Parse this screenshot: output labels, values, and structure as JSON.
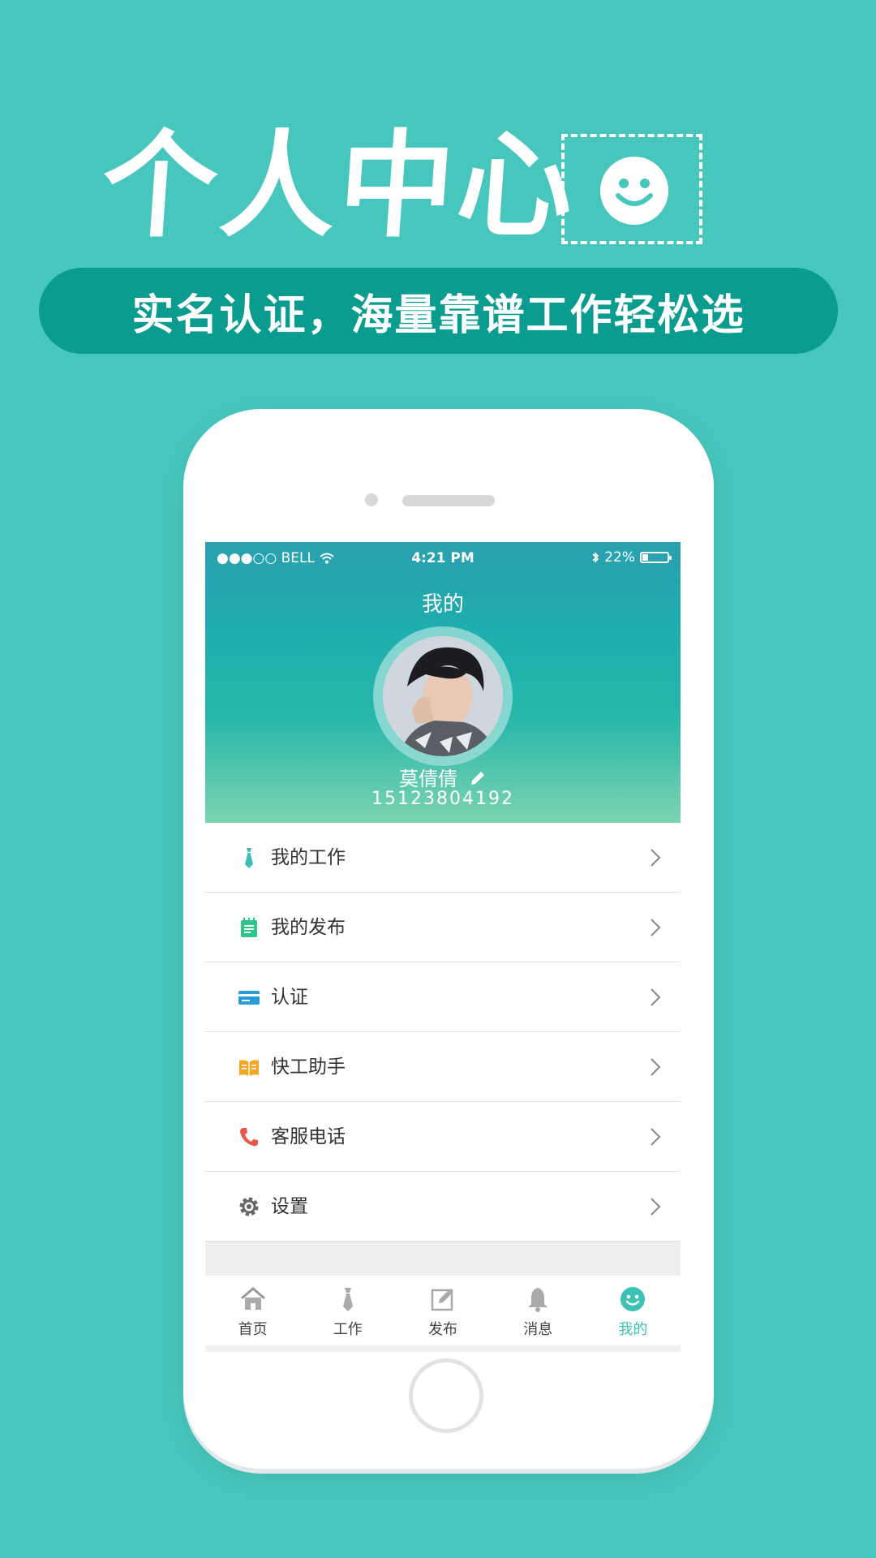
{
  "promo": {
    "headline": "个人中心",
    "banner": "实名认证，海量靠谱工作轻松选"
  },
  "status_bar": {
    "carrier": "●●●○○ BELL",
    "time": "4:21 PM",
    "battery": "22%",
    "battery_level": 0.22
  },
  "screen": {
    "title": "我的",
    "user_name": "莫倩倩",
    "user_phone": "15123804192"
  },
  "menu": {
    "items": [
      {
        "label": "我的工作",
        "icon": "tie-icon",
        "color": "#3bbfb3"
      },
      {
        "label": "我的发布",
        "icon": "notepad-icon",
        "color": "#2ec58a"
      },
      {
        "label": "认证",
        "icon": "id-card-icon",
        "color": "#2a9ad8"
      },
      {
        "label": "快工助手",
        "icon": "book-icon",
        "color": "#f0a824"
      },
      {
        "label": "客服电话",
        "icon": "phone-icon",
        "color": "#e9584d"
      },
      {
        "label": "设置",
        "icon": "gear-icon",
        "color": "#666666"
      }
    ]
  },
  "tabbar": {
    "tabs": [
      {
        "label": "首页",
        "icon": "home-icon"
      },
      {
        "label": "工作",
        "icon": "tie-icon"
      },
      {
        "label": "发布",
        "icon": "edit-icon"
      },
      {
        "label": "消息",
        "icon": "bell-icon"
      },
      {
        "label": "我的",
        "icon": "smiley-icon",
        "active": true
      }
    ]
  },
  "colors": {
    "background": "#47c6bd",
    "banner": "#0a9c8f",
    "accent": "#3cc1b5"
  }
}
